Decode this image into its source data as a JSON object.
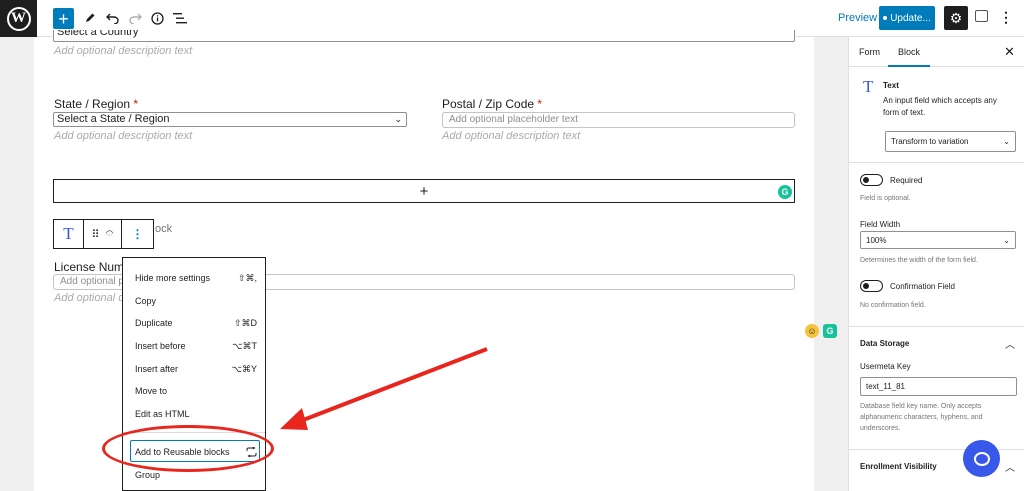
{
  "toolbar": {
    "preview_label": "Preview",
    "update_label": "Update...",
    "icons": [
      "wordpress-logo",
      "plus",
      "pencil",
      "undo",
      "redo",
      "info",
      "list-view",
      "gear",
      "fullscreen",
      "kebab"
    ]
  },
  "form": {
    "country_select_value": "Select a Country",
    "country_description": "Add optional description text",
    "state_label": "State / Region",
    "state_select_value": "Select a State / Region",
    "state_description": "Add optional description text",
    "postal_label": "Postal / Zip Code",
    "postal_placeholder": "Add optional placeholder text",
    "postal_description": "Add optional description text",
    "required_mark": "*",
    "appender_symbol": "+",
    "hidden_block_fragment": "ock",
    "license_label_partial": "License Numb",
    "license_placeholder_partial": "Add optional pla",
    "license_description_partial": "Add optional de"
  },
  "block_menu": {
    "items": [
      {
        "label": "Hide more settings",
        "shortcut": "⇧⌘,"
      },
      {
        "label": "Copy",
        "shortcut": ""
      },
      {
        "label": "Duplicate",
        "shortcut": "⇧⌘D"
      },
      {
        "label": "Insert before",
        "shortcut": "⌥⌘T"
      },
      {
        "label": "Insert after",
        "shortcut": "⌥⌘Y"
      },
      {
        "label": "Move to",
        "shortcut": ""
      },
      {
        "label": "Edit as HTML",
        "shortcut": ""
      },
      {
        "label": "Add to Reusable blocks",
        "shortcut": ""
      },
      {
        "label": "Group",
        "shortcut": ""
      }
    ]
  },
  "sidebar": {
    "tab_form": "Form",
    "tab_block": "Block",
    "block_name": "Text",
    "block_description": "An input field which accepts any form of text.",
    "transform_label": "Transform to variation",
    "required_label": "Required",
    "required_help": "Field is optional.",
    "field_width_label": "Field Width",
    "field_width_value": "100%",
    "field_width_help": "Determines the width of the form field.",
    "confirmation_label": "Confirmation Field",
    "confirmation_help": "No confirmation field.",
    "data_storage_title": "Data Storage",
    "usermeta_label": "Usermeta Key",
    "usermeta_value": "text_11_81",
    "usermeta_help": "Database field key name. Only accepts alphanumeric characters, hyphens, and underscores.",
    "enrollment_title": "Enrollment Visibility"
  },
  "colors": {
    "accent": "#007cba",
    "annotation": "#e8261e",
    "block_icon": "#3858e9",
    "grammarly": "#15c39a"
  }
}
